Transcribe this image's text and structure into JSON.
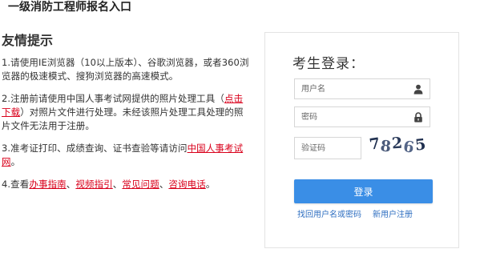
{
  "page": {
    "title": "一级消防工程师报名入口"
  },
  "tips": {
    "heading": "友情提示",
    "item1": {
      "text": "1.请使用IE浏览器（10以上版本）、谷歌浏览器，或者360浏览器的极速模式、搜狗浏览器的高速模式。"
    },
    "item2": {
      "prefix": "2.注册前请使用中国人事考试网提供的照片处理工具（",
      "link": "点击下载",
      "suffix": "）对照片文件进行处理。未经该照片处理工具处理的照片文件无法用于注册。"
    },
    "item3": {
      "prefix": "3.准考证打印、成绩查询、证书查验等请访问",
      "link": "中国人事考试网",
      "suffix": "。"
    },
    "item4": {
      "prefix": "4.查看",
      "link1": "办事指南",
      "sep1": "、",
      "link2": "视频指引",
      "sep2": "、",
      "link3": "常见问题",
      "sep3": "、",
      "link4": "咨询电话",
      "suffix": "。"
    }
  },
  "login": {
    "title": "考生登录：",
    "username_placeholder": "用户名",
    "username_icon": "user-icon",
    "password_placeholder": "密码",
    "password_icon": "lock-icon",
    "captcha_placeholder": "验证码",
    "captcha_value": "78265",
    "button_label": "登录",
    "forgot_link": "找回用户名或密码",
    "register_link": "新用户注册"
  },
  "colors": {
    "accent_blue": "#3a8ee6",
    "link_red": "#d9001b",
    "link_blue": "#2f6fc1"
  }
}
